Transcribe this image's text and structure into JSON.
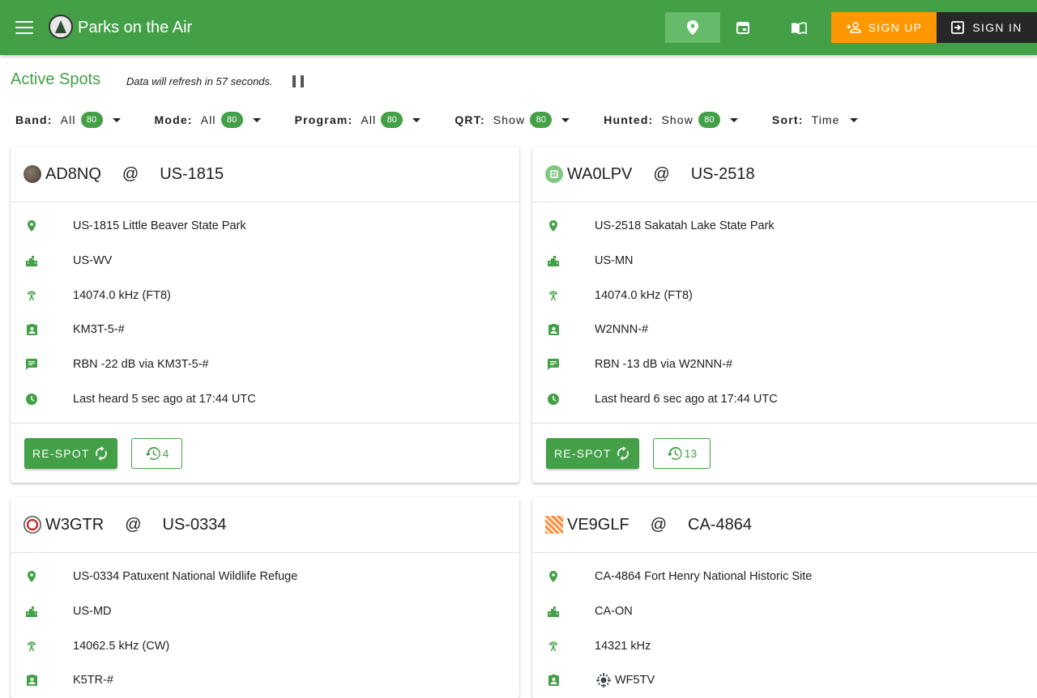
{
  "appbar": {
    "title": "Parks on the Air",
    "signup_label": "SIGN UP",
    "signin_label": "SIGN IN",
    "nav_icons": [
      "map-marker-icon",
      "calendar-icon",
      "book-open-icon"
    ],
    "colors": {
      "primary": "#43a047",
      "signup": "#ff9800",
      "signin": "#272727"
    }
  },
  "header": {
    "title": "Active Spots",
    "refresh_text": "Data will refresh in 57 seconds."
  },
  "filters": [
    {
      "label": "Band:",
      "value": "All",
      "count": "80"
    },
    {
      "label": "Mode:",
      "value": "All",
      "count": "80"
    },
    {
      "label": "Program:",
      "value": "All",
      "count": "80"
    },
    {
      "label": "QRT:",
      "value": "Show",
      "count": "80"
    },
    {
      "label": "Hunted:",
      "value": "Show",
      "count": "80"
    },
    {
      "label": "Sort:",
      "value": "Time",
      "count": ""
    }
  ],
  "cards": [
    {
      "callsign": "AD8NQ",
      "at": "@",
      "park_ref": "US-1815",
      "park": "US-1815  Little Beaver State Park",
      "location": "US-WV",
      "frequency": "14074.0 kHz (FT8)",
      "spotter": "KM3T-5-#",
      "comment": "RBN -22 dB via KM3T-5-#",
      "heard": "Last heard 5 sec ago at 17:44 UTC",
      "respot_label": "RE-SPOT",
      "history_count": "4"
    },
    {
      "callsign": "WA0LPV",
      "at": "@",
      "park_ref": "US-2518",
      "park": "US-2518  Sakatah Lake State Park",
      "location": "US-MN",
      "frequency": "14074.0 kHz (FT8)",
      "spotter": "W2NNN-#",
      "comment": "RBN -13 dB via W2NNN-#",
      "heard": "Last heard 6 sec ago at 17:44 UTC",
      "respot_label": "RE-SPOT",
      "history_count": "13"
    },
    {
      "callsign": "W3GTR",
      "at": "@",
      "park_ref": "US-0334",
      "park": "US-0334  Patuxent National Wildlife Refuge",
      "location": "US-MD",
      "frequency": "14062.5 kHz (CW)",
      "spotter": "K5TR-#"
    },
    {
      "callsign": "VE9GLF",
      "at": "@",
      "park_ref": "CA-4864",
      "park": "CA-4864  Fort Henry National Historic Site",
      "location": "CA-ON",
      "frequency": "14321 kHz",
      "spotter": "WF5TV"
    }
  ]
}
